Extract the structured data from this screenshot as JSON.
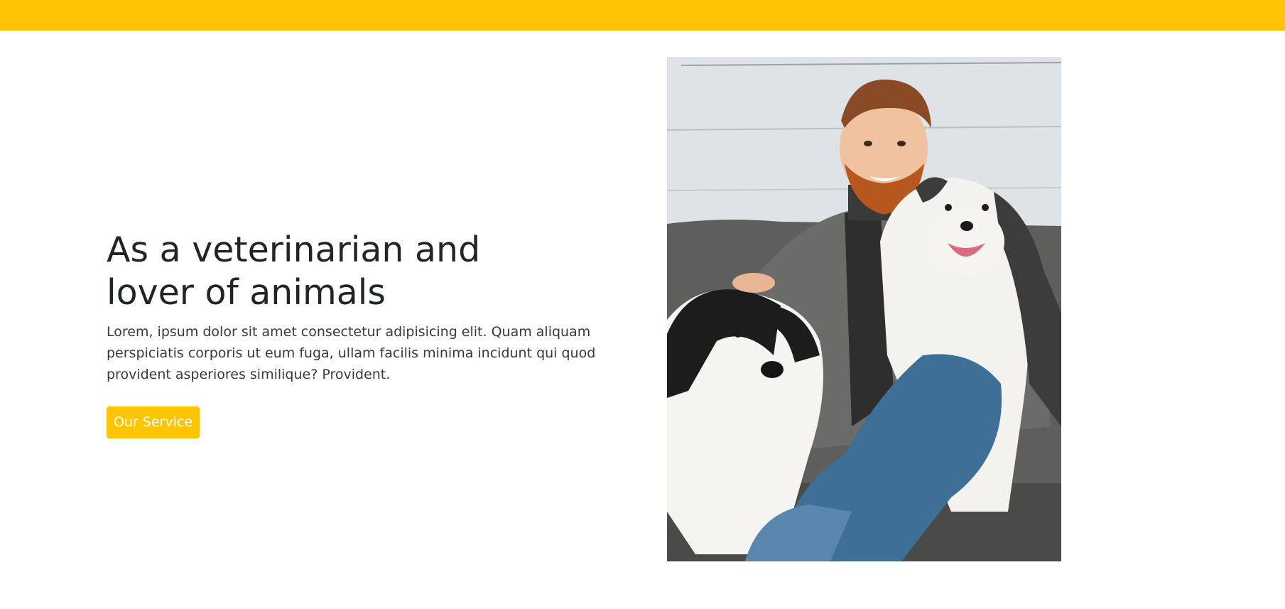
{
  "hero": {
    "title": "As a veterinarian and lover of animals",
    "description": "Lorem, ipsum dolor sit amet consectetur adipisicing elit. Quam aliquam perspiciatis corporis ut eum fuga, ullam facilis minima incidunt qui quod provident asperiores similique? Provident.",
    "cta_label": "Our Service"
  },
  "colors": {
    "accent": "#ffc505",
    "heading": "#212529",
    "body_text": "#333a40",
    "button_text": "#ffffff"
  }
}
